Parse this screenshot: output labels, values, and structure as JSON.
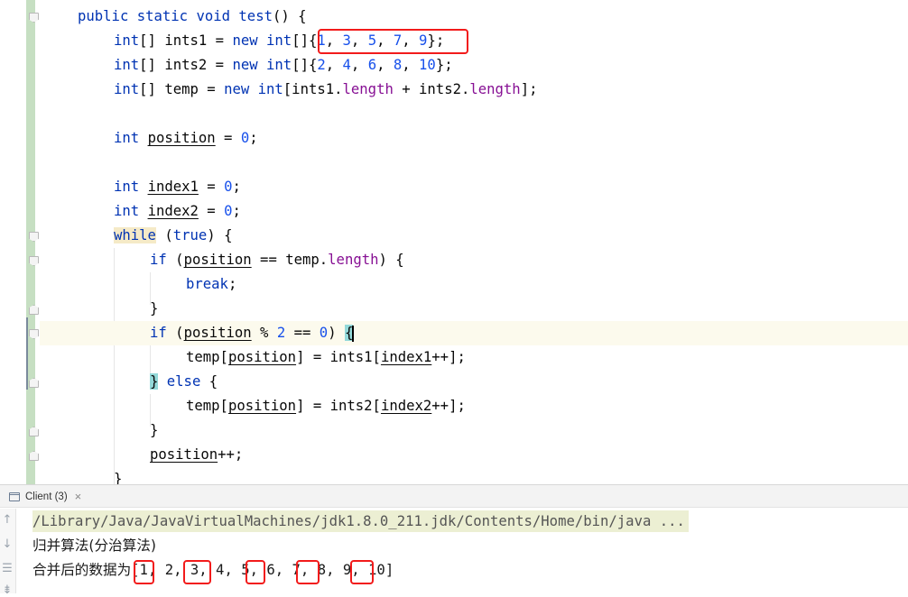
{
  "editor": {
    "lines": {
      "l1": {
        "kw1": "public",
        "kw2": "static",
        "kw3": "void",
        "name": "test",
        "rest": "() {"
      },
      "l2": {
        "type": "int",
        "decl": "[] ints1 = ",
        "kw": "new",
        "type2": "int",
        "arr": "[]",
        "open": "{",
        "n1": "1",
        "n2": "3",
        "n3": "5",
        "n4": "7",
        "n5": "9",
        "close": "};"
      },
      "l3": {
        "type": "int",
        "decl": "[] ints2 = ",
        "kw": "new",
        "type2": "int",
        "arr": "[]{",
        "n1": "2",
        "n2": "4",
        "n3": "6",
        "n4": "8",
        "n5": "10",
        "close": "};"
      },
      "l4": {
        "type": "int",
        "decl": "[] temp = ",
        "kw": "new",
        "type2": "int",
        "a": "[ints1.",
        "f1": "length",
        "b": " + ints2.",
        "f2": "length",
        "c": "];"
      },
      "l6": {
        "type": "int",
        "var": "position",
        "eq": " = ",
        "val": "0",
        "end": ";"
      },
      "l8": {
        "type": "int",
        "var": "index1",
        "eq": " = ",
        "val": "0",
        "end": ";"
      },
      "l9": {
        "type": "int",
        "var": "index2",
        "eq": " = ",
        "val": "0",
        "end": ";"
      },
      "l10": {
        "kw": "while",
        "open": " (",
        "val": "true",
        "close": ") {"
      },
      "l11": {
        "kw": "if",
        "open": " (",
        "var": "position",
        "op": " == temp.",
        "f": "length",
        "close": ") {"
      },
      "l12": {
        "kw": "break",
        "end": ";"
      },
      "l13": {
        "text": "}"
      },
      "l14": {
        "kw": "if",
        "open": " (",
        "var": "position",
        "op": " % ",
        "n1": "2",
        "op2": " == ",
        "n2": "0",
        "close": ") ",
        "brace": "{"
      },
      "l15": {
        "a": "temp[",
        "var": "position",
        "b": "] = ints1[",
        "idx": "index1",
        "c": "++];"
      },
      "l16": {
        "brace": "}",
        "kw": "else",
        "rest": " {"
      },
      "l17": {
        "a": "temp[",
        "var": "position",
        "b": "] = ints2[",
        "idx": "index2",
        "c": "++];"
      },
      "l18": {
        "text": "}"
      },
      "l19": {
        "var": "position",
        "rest": "++;"
      },
      "l20": {
        "text": "}"
      }
    }
  },
  "run_panel": {
    "tab_label": "Client (3)",
    "tab_close": "×",
    "tools": {
      "up": "↑",
      "down": "↓",
      "wrap": "☰",
      "filter": "⇟"
    },
    "output": {
      "path": "/Library/Java/JavaVirtualMachines/jdk1.8.0_211.jdk/Contents/Home/bin/java ...",
      "line2": "归并算法(分治算法)",
      "line3_prefix": "合并后的数据为",
      "line3_values": "[1, 2, 3, 4, 5, 6, 7, 8, 9, 10]"
    }
  },
  "colors": {
    "keyword": "#0033b3",
    "number": "#1750eb",
    "field": "#871094",
    "highlight_box": "#f21b1b",
    "gutter": "#c6dfc2"
  }
}
